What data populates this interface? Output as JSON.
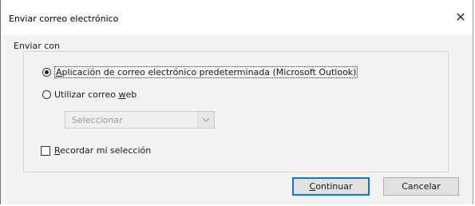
{
  "window": {
    "title": "Enviar correo electrónico",
    "close_glyph": "✕"
  },
  "send_with": {
    "legend": "Enviar con",
    "options": [
      {
        "label": "Aplicación de correo electrónico predeterminada (Microsoft Outlook)",
        "mnemonic": "A",
        "selected": true
      },
      {
        "label": "Utilizar correo web",
        "mnemonic": "w",
        "selected": false
      }
    ],
    "webmail_select": {
      "value": "Seleccionar",
      "disabled": true
    }
  },
  "remember": {
    "label": "Recordar mi selección",
    "mnemonic": "R",
    "checked": false
  },
  "buttons": {
    "continue": "Continuar",
    "cancel": "Cancelar"
  },
  "colors": {
    "focus_border": "#0078d7",
    "dialog_bg": "#f3f3f3"
  },
  "icons": {
    "close": "close-icon",
    "dropdown": "chevron-down-icon"
  }
}
